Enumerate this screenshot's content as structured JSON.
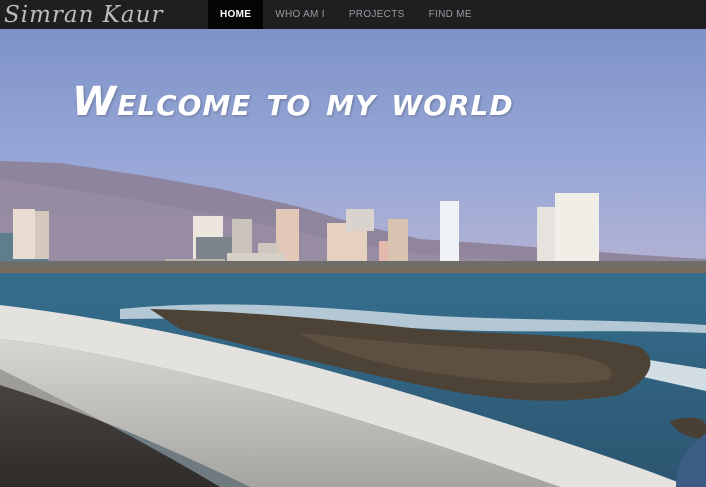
{
  "brand": {
    "name": "Simran Kaur"
  },
  "nav": {
    "items": [
      {
        "label": "HOME",
        "active": true
      },
      {
        "label": "WHO AM I",
        "active": false
      },
      {
        "label": "PROJECTS",
        "active": false
      },
      {
        "label": "FIND ME",
        "active": false
      }
    ]
  },
  "hero": {
    "headline": "Welcome to my world"
  },
  "colors": {
    "navbar_bg": "#1f1e21",
    "nav_active_bg": "#050505",
    "nav_text": "#9b9b9f",
    "sky": "#8fa0cf",
    "sea": "#2f5f7d"
  }
}
